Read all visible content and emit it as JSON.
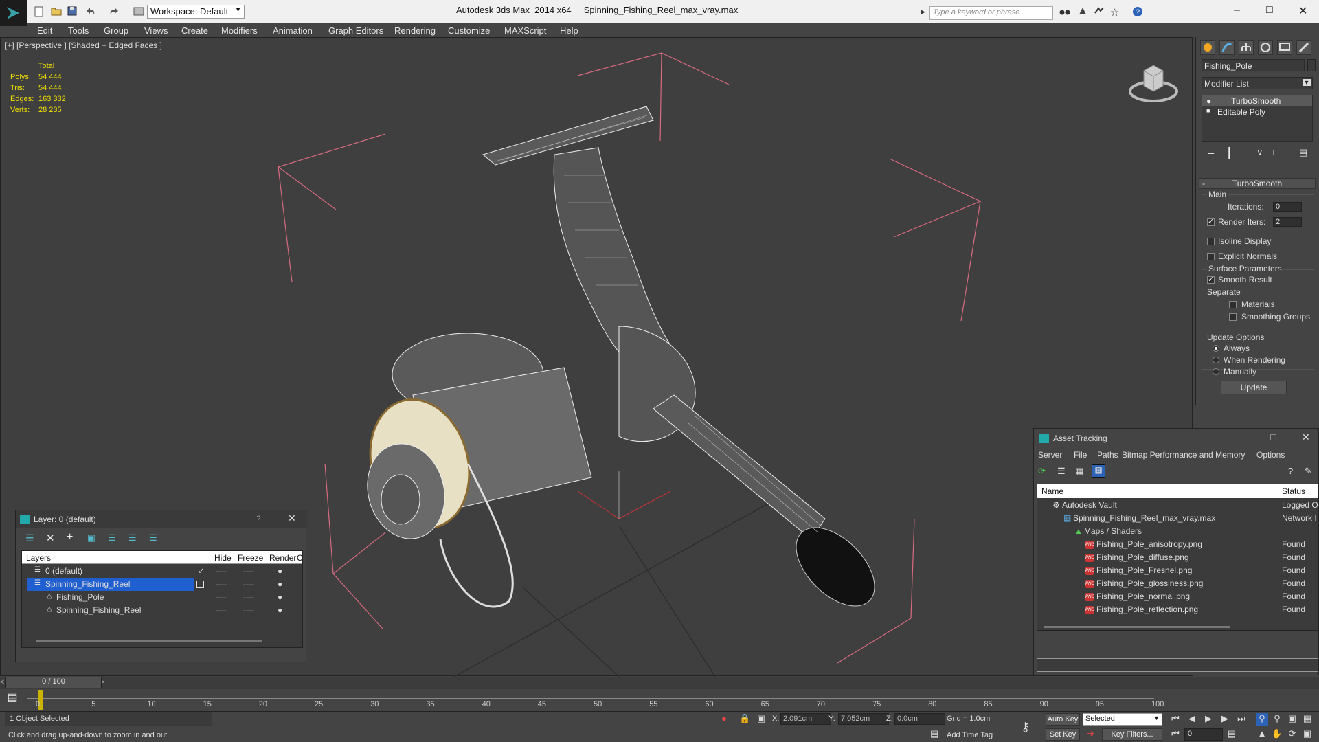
{
  "app": {
    "title": "Autodesk 3ds Max  2014 x64     Spinning_Fishing_Reel_max_vray.max",
    "workspace": "Workspace: Default",
    "search_placeholder": "Type a keyword or phrase"
  },
  "menu": [
    "Edit",
    "Tools",
    "Group",
    "Views",
    "Create",
    "Modifiers",
    "Animation",
    "Graph Editors",
    "Rendering",
    "Customize",
    "MAXScript",
    "Help"
  ],
  "viewport": {
    "label": "[+] [Perspective ] [Shaded + Edged Faces ]",
    "stats": {
      "header": "Total",
      "rows": [
        {
          "label": "Polys:",
          "value": "54 444"
        },
        {
          "label": "Tris:",
          "value": "54 444"
        },
        {
          "label": "Edges:",
          "value": "163 332"
        },
        {
          "label": "Verts:",
          "value": "28 235"
        }
      ]
    }
  },
  "cmd": {
    "object_name": "Fishing_Pole",
    "modifier_list": "Modifier List",
    "stack": [
      "TurboSmooth",
      "Editable Poly"
    ],
    "rollout": "TurboSmooth",
    "main_group": "Main",
    "iterations_label": "Iterations:",
    "iterations_value": "0",
    "render_iters_label": "Render Iters:",
    "render_iters_value": "2",
    "isoline": "Isoline Display",
    "explicit_normals": "Explicit Normals",
    "surface_params": "Surface Parameters",
    "smooth_result": "Smooth Result",
    "separate": "Separate",
    "materials": "Materials",
    "smoothing_groups": "Smoothing Groups",
    "update_options": "Update Options",
    "always": "Always",
    "when_rendering": "When Rendering",
    "manually": "Manually",
    "update_btn": "Update"
  },
  "layers": {
    "title": "Layer: 0 (default)",
    "help": "?",
    "columns": [
      "Layers",
      "Hide",
      "Freeze",
      "Render",
      "C"
    ],
    "rows": [
      {
        "name": "0 (default)"
      },
      {
        "name": "Spinning_Fishing_Reel"
      },
      {
        "name": "Fishing_Pole"
      },
      {
        "name": "Spinning_Fishing_Reel"
      }
    ]
  },
  "asset": {
    "title": "Asset Tracking",
    "menu": [
      "Server",
      "File",
      "Paths",
      "Bitmap Performance and Memory",
      "Options"
    ],
    "col_name": "Name",
    "col_status": "Status",
    "rows": [
      {
        "name": "Autodesk Vault",
        "status": "Logged O"
      },
      {
        "name": "Spinning_Fishing_Reel_max_vray.max",
        "status": "Network I"
      },
      {
        "name": "Maps / Shaders",
        "status": ""
      },
      {
        "name": "Fishing_Pole_anisotropy.png",
        "status": "Found"
      },
      {
        "name": "Fishing_Pole_diffuse.png",
        "status": "Found"
      },
      {
        "name": "Fishing_Pole_Fresnel.png",
        "status": "Found"
      },
      {
        "name": "Fishing_Pole_glossiness.png",
        "status": "Found"
      },
      {
        "name": "Fishing_Pole_normal.png",
        "status": "Found"
      },
      {
        "name": "Fishing_Pole_reflection.png",
        "status": "Found"
      }
    ]
  },
  "timeline": {
    "frame": "0 / 100",
    "ticks": [
      "0",
      "5",
      "10",
      "15",
      "20",
      "25",
      "30",
      "35",
      "40",
      "45",
      "50",
      "55",
      "60",
      "65",
      "70",
      "75",
      "80",
      "85",
      "90",
      "95",
      "100"
    ]
  },
  "status": {
    "selected": "1 Object Selected",
    "prompt": "Click and drag up-and-down to zoom in and out",
    "x_label": "X:",
    "x": "2.091cm",
    "y_label": "Y:",
    "y": "7.052cm",
    "z_label": "Z:",
    "z": "0.0cm",
    "grid": "Grid = 1.0cm",
    "auto_key": "Auto Key",
    "selected_dropdown": "Selected",
    "set_key": "Set Key",
    "key_filters": "Key Filters...",
    "add_time_tag": "Add Time Tag",
    "frame_value": "0"
  }
}
